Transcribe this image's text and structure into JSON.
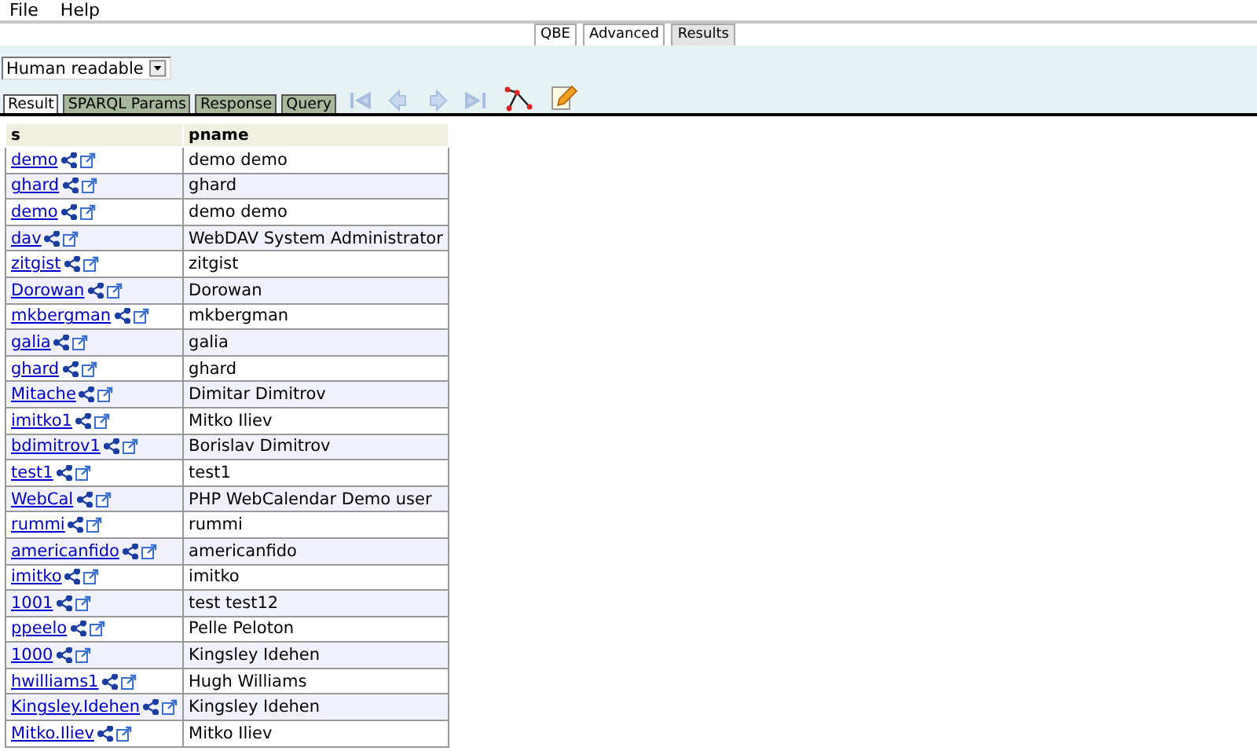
{
  "menu": [
    "File",
    "Help"
  ],
  "top_tabs": [
    {
      "label": "QBE",
      "selected": false
    },
    {
      "label": "Advanced",
      "selected": false
    },
    {
      "label": "Results",
      "selected": true
    }
  ],
  "format_select": {
    "value": "Human readable"
  },
  "tabs": [
    {
      "label": "Result",
      "selected": true
    },
    {
      "label": "SPARQL Params",
      "selected": false
    },
    {
      "label": "Response",
      "selected": false
    },
    {
      "label": "Query",
      "selected": false
    }
  ],
  "table": {
    "columns": [
      "s",
      "pname"
    ],
    "rows": [
      {
        "s": "demo",
        "pname": "demo demo"
      },
      {
        "s": "ghard",
        "pname": "ghard"
      },
      {
        "s": "demo",
        "pname": "demo demo"
      },
      {
        "s": "dav",
        "pname": "WebDAV System Administrator"
      },
      {
        "s": "zitgist",
        "pname": "zitgist"
      },
      {
        "s": "Dorowan",
        "pname": "Dorowan"
      },
      {
        "s": "mkbergman",
        "pname": "mkbergman"
      },
      {
        "s": "galia",
        "pname": "galia"
      },
      {
        "s": "ghard",
        "pname": "ghard"
      },
      {
        "s": "Mitache",
        "pname": "Dimitar Dimitrov"
      },
      {
        "s": "imitko1",
        "pname": "Mitko Iliev"
      },
      {
        "s": "bdimitrov1",
        "pname": "Borislav Dimitrov"
      },
      {
        "s": "test1",
        "pname": "test1"
      },
      {
        "s": "WebCal",
        "pname": "PHP WebCalendar Demo user"
      },
      {
        "s": "rummi",
        "pname": "rummi"
      },
      {
        "s": "americanfido",
        "pname": "americanfido"
      },
      {
        "s": "imitko",
        "pname": "imitko"
      },
      {
        "s": "1001",
        "pname": "test test12"
      },
      {
        "s": "ppeelo",
        "pname": "Pelle Peloton"
      },
      {
        "s": "1000",
        "pname": "Kingsley Idehen"
      },
      {
        "s": "hwilliams1",
        "pname": "Hugh Williams"
      },
      {
        "s": "Kingsley.Idehen",
        "pname": "Kingsley Idehen"
      },
      {
        "s": "Mitko.Iliev",
        "pname": "Mitko Iliev"
      }
    ]
  }
}
